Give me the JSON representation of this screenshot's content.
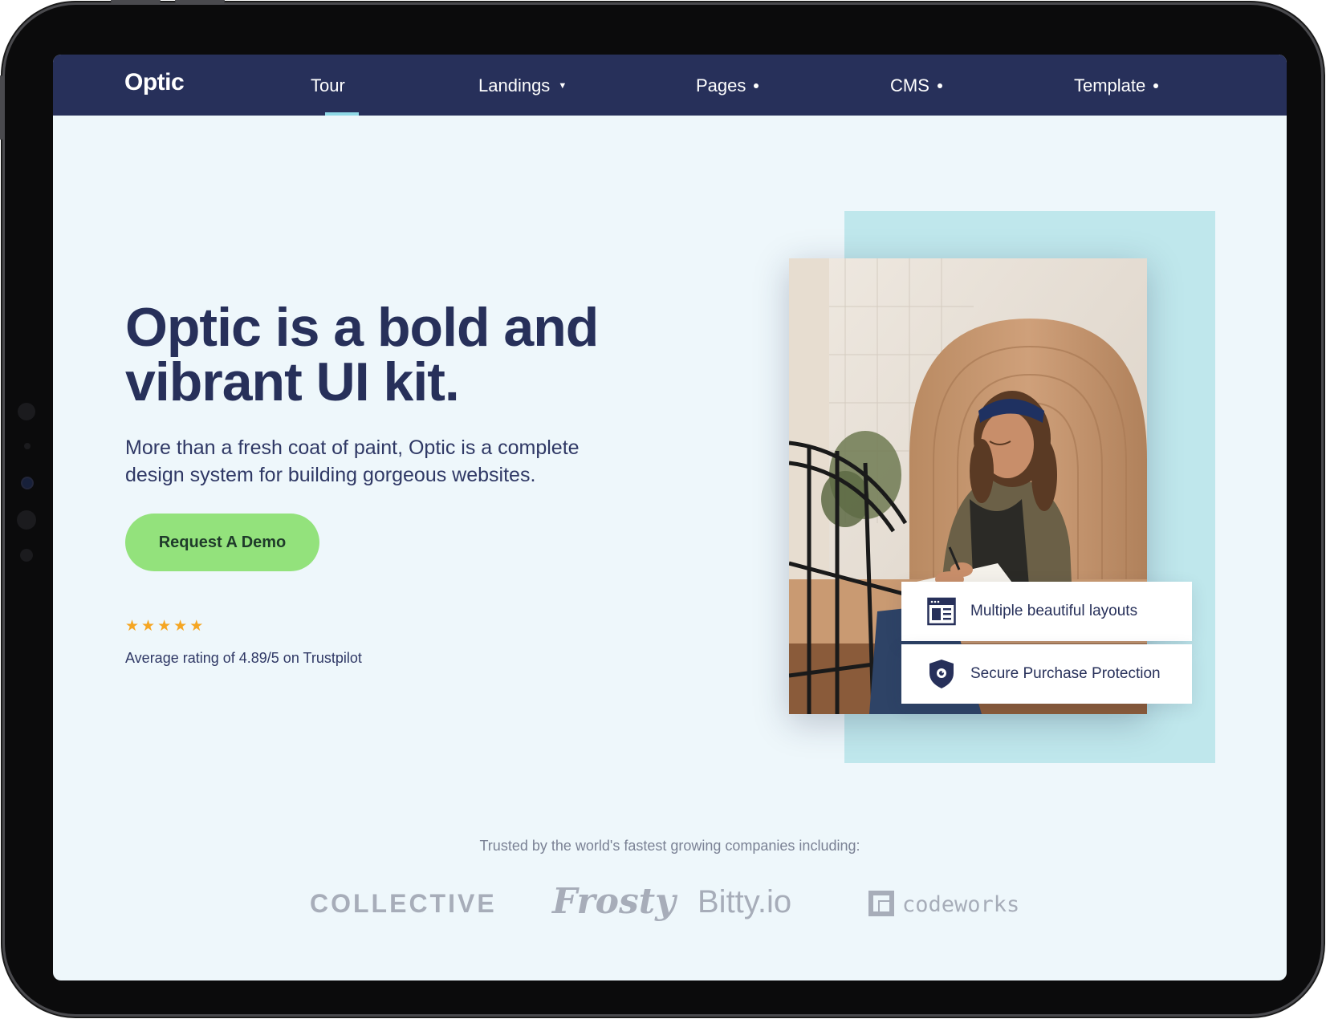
{
  "nav": {
    "logo": "Optic",
    "items": [
      {
        "label": "Tour"
      },
      {
        "label": "Landings"
      },
      {
        "label": "Pages"
      },
      {
        "label": "CMS"
      },
      {
        "label": "Template"
      }
    ]
  },
  "hero": {
    "headline_line1": "Optic is a bold and",
    "headline_line2": "vibrant UI kit.",
    "lede_line1": "More than a fresh coat of paint, Optic is a complete",
    "lede_line2": "design system for building gorgeous websites.",
    "cta_label": "Request A Demo",
    "star_count": 5,
    "rating_text": "Average rating of 4.89/5 on Trustpilot"
  },
  "features": [
    {
      "icon": "layout-icon",
      "label": "Multiple beautiful layouts"
    },
    {
      "icon": "shield-icon",
      "label": "Secure Purchase Protection"
    }
  ],
  "trusted": {
    "heading": "Trusted by the world's fastest growing companies including:",
    "brands": [
      "COLLECTIVE",
      "Frosty",
      "Bitty.io",
      "codeworks"
    ]
  },
  "colors": {
    "nav_bg": "#27305a",
    "page_bg": "#eef7fb",
    "cta_bg": "#93e27c",
    "star": "#f5a623",
    "backdrop": "#bfe7ec"
  }
}
